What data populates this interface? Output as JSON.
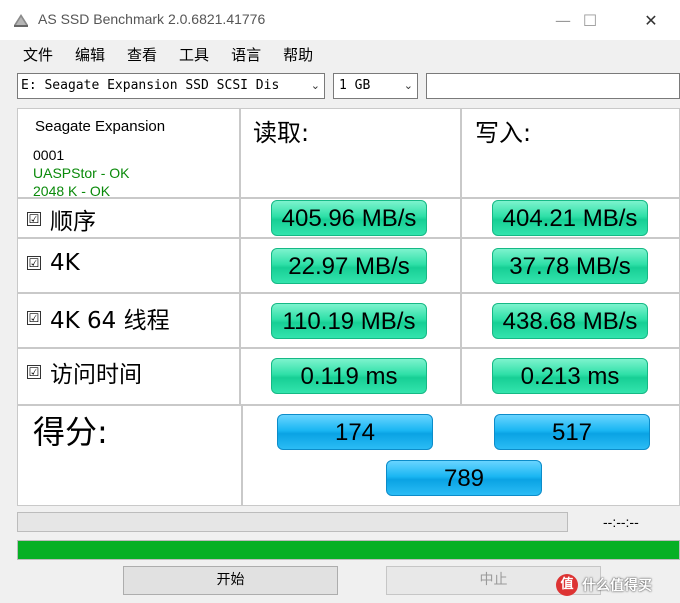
{
  "window": {
    "title": "AS SSD Benchmark 2.0.6821.41776",
    "minimize_glyph": "—",
    "maximize_glyph": "☐",
    "close_glyph": "✕"
  },
  "menu": {
    "items": [
      "文件",
      "编辑",
      "查看",
      "工具",
      "语言",
      "帮助"
    ]
  },
  "toolbar": {
    "drive_value": "E: Seagate Expansion SSD SCSI Dis",
    "size_value": "1 GB",
    "search_value": ""
  },
  "drive_info": {
    "name": "Seagate Expansion",
    "firmware": "0001",
    "driver": "UASPStor - OK",
    "alignment": "2048 K - OK"
  },
  "columns": {
    "read": "读取:",
    "write": "写入:"
  },
  "rows": [
    {
      "label": "顺序",
      "checked": "☑",
      "read": "405.96 MB/s",
      "write": "404.21 MB/s"
    },
    {
      "label": "4K",
      "checked": "☑",
      "read": "22.97 MB/s",
      "write": "37.78 MB/s"
    },
    {
      "label": "4K 64 线程",
      "checked": "☑",
      "read": "110.19 MB/s",
      "write": "438.68 MB/s"
    },
    {
      "label": "访问时间",
      "checked": "☑",
      "read": "0.119 ms",
      "write": "0.213 ms"
    }
  ],
  "score": {
    "label": "得分:",
    "read": "174",
    "write": "517",
    "total": "789"
  },
  "progress": {
    "time": "--:--:--",
    "overall_fraction": 1.0
  },
  "buttons": {
    "start": "开始",
    "stop": "中止"
  },
  "watermark": {
    "icon": "值",
    "text": "什么值得买"
  },
  "colors": {
    "result_pill": "#2fe0a8",
    "score_pill": "#1bb7f3",
    "progress_fill": "#06b025",
    "ok_text": "#0a8a0a"
  }
}
